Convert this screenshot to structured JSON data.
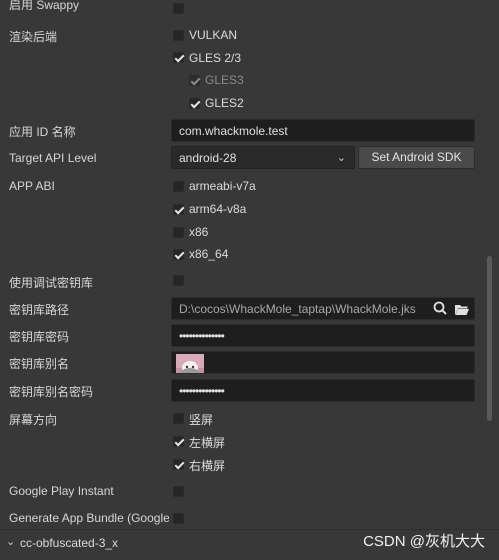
{
  "settings": {
    "swappy": {
      "label": "启用 Swappy",
      "checked": false
    },
    "render_backend": {
      "label": "渲染后端",
      "vulkan": {
        "label": "VULKAN",
        "checked": false
      },
      "gles23": {
        "label": "GLES 2/3",
        "checked": true
      },
      "gles3": {
        "label": "GLES3",
        "checked": true,
        "disabled": true
      },
      "gles2": {
        "label": "GLES2",
        "checked": true
      }
    },
    "app_id": {
      "label": "应用 ID 名称",
      "value": "com.whackmole.test"
    },
    "target_api": {
      "label": "Target API Level",
      "value": "android-28",
      "button": "Set Android SDK"
    },
    "app_abi": {
      "label": "APP ABI",
      "armeabi": {
        "label": "armeabi-v7a",
        "checked": false
      },
      "arm64": {
        "label": "arm64-v8a",
        "checked": true
      },
      "x86": {
        "label": "x86",
        "checked": false
      },
      "x86_64": {
        "label": "x86_64",
        "checked": true
      }
    },
    "debug_keystore": {
      "label": "使用调试密钥库",
      "checked": false
    },
    "keystore_path": {
      "label": "密钥库路径",
      "value": "D:\\cocos\\WhackMole_taptap\\WhackMole.jks"
    },
    "keystore_password": {
      "label": "密钥库密码",
      "value": "••••••••••••••"
    },
    "keystore_alias": {
      "label": "密钥库别名"
    },
    "alias_password": {
      "label": "密钥库别名密码",
      "value": "••••••••••••••"
    },
    "orientation": {
      "label": "屏幕方向",
      "portrait": {
        "label": "竖屏",
        "checked": false
      },
      "landscape_left": {
        "label": "左横屏",
        "checked": true
      },
      "landscape_right": {
        "label": "右横屏",
        "checked": true
      }
    },
    "google_play_instant": {
      "label": "Google Play Instant",
      "checked": false
    },
    "app_bundle": {
      "label": "Generate App Bundle (Google Play)",
      "checked": false
    }
  },
  "section": {
    "title": "cc-obfuscated-3_x"
  },
  "watermark": "CSDN @灰机大大",
  "icons": {
    "search": "search-icon",
    "folder": "folder-open-icon",
    "avatar": "alias-avatar-image",
    "chevron": "chevron-down-icon"
  }
}
